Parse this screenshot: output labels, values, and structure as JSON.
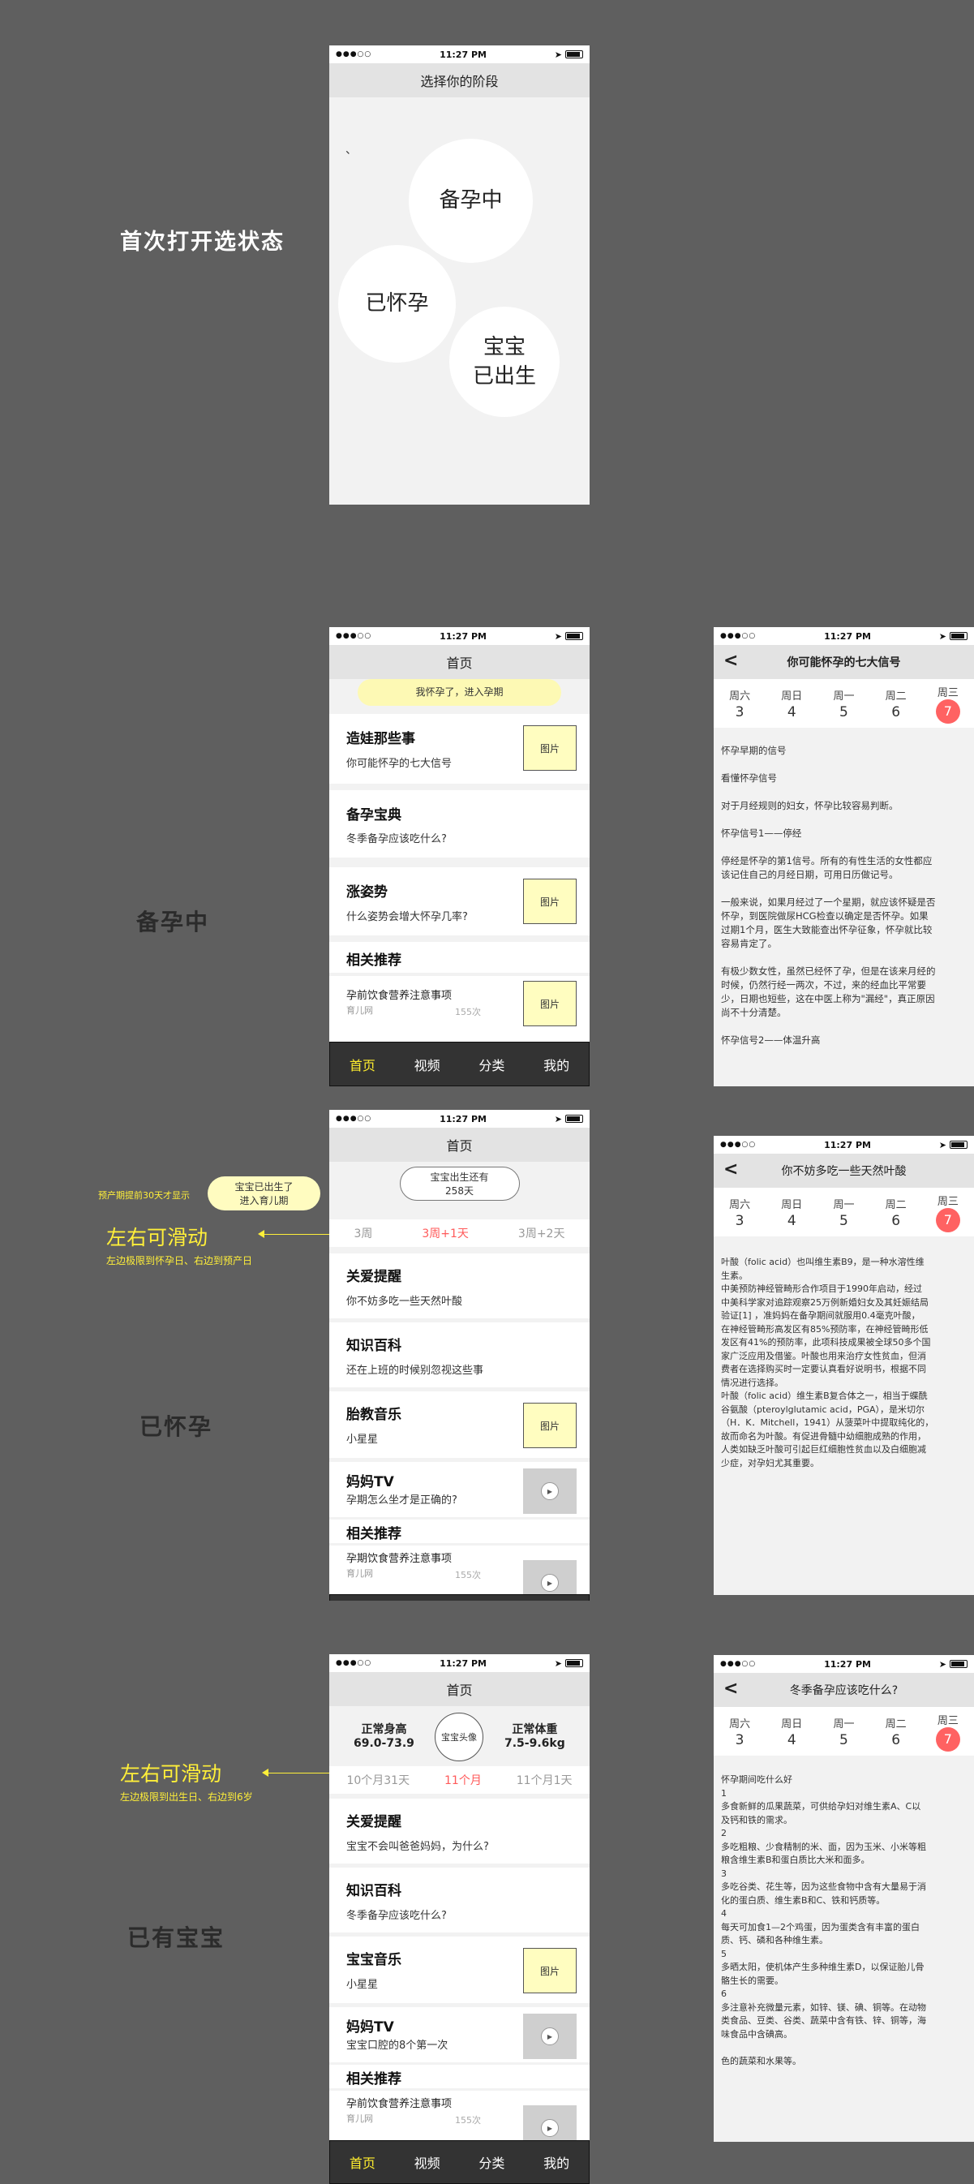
{
  "status": {
    "signal": "●●●○○",
    "time": "11:27 PM"
  },
  "labels": {
    "first_open": "首次打开选状态",
    "preparing": "备孕中",
    "pregnant": "已怀孕",
    "has_baby": "已有宝宝",
    "due_note": "预产期提前30天才显示",
    "swipe": "左右可滑动",
    "swipe_pregnant_hint": "左边极限到怀孕日、右边到预产日",
    "swipe_baby_hint": "左边极限到出生日、右边到6岁",
    "born_bubble_1": "宝宝已出生了",
    "born_bubble_2": "进入育儿期"
  },
  "screen1": {
    "title": "选择你的阶段",
    "tick": "、",
    "options": [
      "备孕中",
      "已怀孕",
      "宝宝",
      "已出生"
    ]
  },
  "tabs": [
    "首页",
    "视频",
    "分类",
    "我的"
  ],
  "home_prep": {
    "title": "首页",
    "pill": "我怀孕了，进入孕期",
    "cards": [
      {
        "t": "造娃那些事",
        "s": "你可能怀孕的七大信号",
        "img": "图片"
      },
      {
        "t": "备孕宝典",
        "s": "冬季备孕应该吃什么?"
      },
      {
        "t": "涨姿势",
        "s": "什么姿势会增大怀孕几率?",
        "img": "图片"
      }
    ],
    "rec": {
      "title": "相关推荐",
      "item": "孕前饮食营养注意事项",
      "source": "育儿网",
      "count": "155次",
      "img": "图片"
    }
  },
  "article1": {
    "title": "你可能怀孕的七大信号",
    "days": [
      {
        "w": "周六",
        "n": "3"
      },
      {
        "w": "周日",
        "n": "4"
      },
      {
        "w": "周一",
        "n": "5"
      },
      {
        "w": "周二",
        "n": "6"
      },
      {
        "w": "周三",
        "n": "7"
      }
    ],
    "body": "怀孕早期的信号\n\n看懂怀孕信号\n\n对于月经规则的妇女，怀孕比较容易判断。\n\n怀孕信号1——停经\n\n停经是怀孕的第1信号。所有的有性生活的女性都应\n该记住自己的月经日期，可用日历做记号。\n\n一般来说，如果月经过了一个星期，就应该怀疑是否\n怀孕，到医院做尿HCG检查以确定是否怀孕。如果\n过期1个月，医生大致能查出怀孕征象，怀孕就比较\n容易肯定了。\n\n有极少数女性，虽然已经怀了孕，但是在该来月经的\n时候，仍然行经一两次，不过，来的经血比平常要\n少，日期也短些，这在中医上称为\"漏经\"，真正原因\n尚不十分清楚。\n\n怀孕信号2——体温升高"
  },
  "home_preg": {
    "title": "首页",
    "countdown_1": "宝宝出生还有",
    "countdown_2": "258天",
    "weeks": [
      "3周",
      "3周+1天",
      "3周+2天"
    ],
    "cards": [
      {
        "t": "关爱提醒",
        "s": "你不妨多吃一些天然叶酸"
      },
      {
        "t": "知识百科",
        "s": "还在上班的时候别忽视这些事"
      },
      {
        "t": "胎教音乐",
        "s": "小星星",
        "img": "图片"
      },
      {
        "t": "妈妈TV",
        "s": "孕期怎么坐才是正确的?"
      }
    ],
    "rec": {
      "title": "相关推荐",
      "item": "孕期饮食营养注意事项",
      "source": "育儿网",
      "count": "155次"
    }
  },
  "article2": {
    "title": "你不妨多吃一些天然叶酸",
    "body": "叶酸（folic acid）也叫维生素B9，是一种水溶性维\n生素。\n中美预防神经管畸形合作项目于1990年启动，经过\n中美科学家对追踪观察25万例新婚妇女及其妊娠结局\n验证[1] ，准妈妈在备孕期间就服用0.4毫克叶酸，\n在神经管畸形高发区有85%预防率，在神经管畸形低\n发区有41%的预防率，此项科技成果被全球50多个国\n家广泛应用及借鉴。叶酸也用来治疗女性贫血，但消\n费者在选择购买时一定要认真看好说明书，根据不同\n情况进行选择。\n叶酸（folic acid）维生素B复合体之一，相当于蝶酰\n谷氨酸（pteroylglutamic acid，PGA），是米切尔\n（H．K．Mitchell，1941）从菠菜叶中提取纯化的，\n故而命名为叶酸。有促进骨髓中幼细胞成熟的作用，\n人类如缺乏叶酸可引起巨红细胞性贫血以及白细胞减\n少症，对孕妇尤其重要。"
  },
  "home_baby": {
    "title": "首页",
    "height_label": "正常身高",
    "height_val": "69.0-73.9",
    "avatar": "宝宝头像",
    "weight_label": "正常体重",
    "weight_val": "7.5-9.6kg",
    "months": [
      "10个月31天",
      "11个月",
      "11个月1天"
    ],
    "cards": [
      {
        "t": "关爱提醒",
        "s": "宝宝不会叫爸爸妈妈，为什么?"
      },
      {
        "t": "知识百科",
        "s": "冬季备孕应该吃什么?"
      },
      {
        "t": "宝宝音乐",
        "s": "小星星",
        "img": "图片"
      },
      {
        "t": "妈妈TV",
        "s": "宝宝口腔的8个第一次"
      }
    ],
    "rec": {
      "title": "相关推荐",
      "item": "孕前饮食营养注意事项",
      "source": "育儿网",
      "count": "155次"
    }
  },
  "article3": {
    "title": "冬季备孕应该吃什么?",
    "body": "怀孕期间吃什么好\n1\n多食新鲜的瓜果蔬菜，可供给孕妇对维生素A、C以\n及钙和铁的需求。\n2\n多吃粗粮、少食精制的米、面，因为玉米、小米等粗\n粮含维生素B和蛋白质比大米和面多。\n3\n多吃谷类、花生等，因为这些食物中含有大量易于消\n化的蛋白质、维生素B和C、铁和钙质等。\n4\n每天可加食1—2个鸡蛋，因为蛋类含有丰富的蛋白\n质、钙、磷和各种维生素。\n5\n多晒太阳，使机体产生多种维生素D，以保证胎儿骨\n骼生长的需要。\n6\n多注意补充微量元素，如锌、镁、碘、铜等。在动物\n类食品、豆类、谷类、蔬菜中含有铁、锌、铜等，海\n味食品中含碘高。\n\n色的蔬菜和水果等。"
  }
}
